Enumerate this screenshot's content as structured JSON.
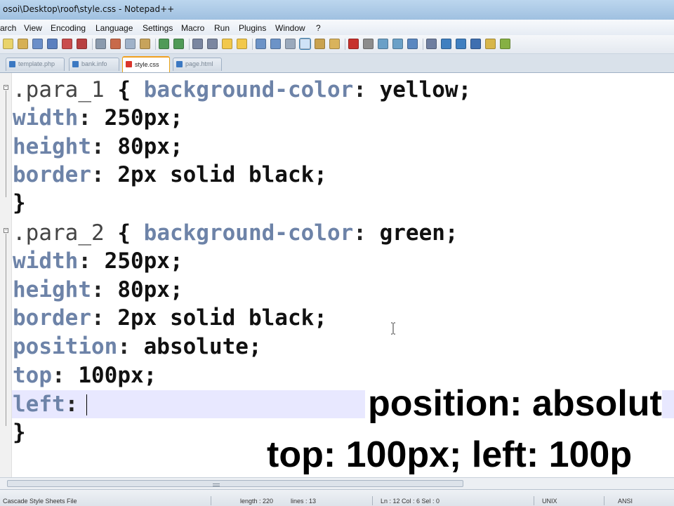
{
  "window": {
    "title": "osoi\\Desktop\\roof\\style.css - Notepad++"
  },
  "menu": {
    "items": [
      "arch",
      "View",
      "Encoding",
      "Language",
      "Settings",
      "Macro",
      "Run",
      "Plugins",
      "Window",
      "?"
    ]
  },
  "toolbar": {
    "icons": [
      "new-file-icon",
      "open-file-icon",
      "save-icon",
      "save-all-icon",
      "close-icon",
      "close-all-icon",
      "print-icon",
      "cut-icon",
      "copy-icon",
      "paste-icon",
      "undo-icon",
      "redo-icon",
      "find-icon",
      "replace-icon",
      "zoom-in-icon",
      "zoom-out-icon",
      "sync-scroll-icon",
      "word-wrap-icon",
      "show-all-chars-icon",
      "indent-guide-icon",
      "user-lang-icon",
      "doc-map-icon",
      "record-macro-icon",
      "stop-macro-icon",
      "play-macro-icon",
      "play-multi-icon",
      "save-macro-icon",
      "trim-icon",
      "up-icon",
      "down-icon",
      "collapse-icon",
      "fold-icon",
      "spell-icon"
    ]
  },
  "tabs": [
    {
      "label": "template.php",
      "active": false
    },
    {
      "label": "bank.info",
      "active": false
    },
    {
      "label": "style.css",
      "active": true
    },
    {
      "label": "page.html",
      "active": false
    }
  ],
  "editor": {
    "lines": [
      [
        {
          "t": ".para_1",
          "c": "sel-k"
        },
        {
          "t": " { ",
          "c": "brc"
        },
        {
          "t": "background-color",
          "c": "prop"
        },
        {
          "t": ": ",
          "c": "pun"
        },
        {
          "t": "yellow;",
          "c": "val"
        }
      ],
      [
        {
          "t": "width",
          "c": "prop"
        },
        {
          "t": ": ",
          "c": "pun"
        },
        {
          "t": "250px;",
          "c": "val"
        }
      ],
      [
        {
          "t": "height",
          "c": "prop"
        },
        {
          "t": ": ",
          "c": "pun"
        },
        {
          "t": "80px;",
          "c": "val"
        }
      ],
      [
        {
          "t": "border",
          "c": "prop"
        },
        {
          "t": ": ",
          "c": "pun"
        },
        {
          "t": "2px solid black;",
          "c": "val"
        }
      ],
      [
        {
          "t": "}",
          "c": "brc"
        }
      ],
      [
        {
          "t": ".para_2",
          "c": "sel-k"
        },
        {
          "t": " { ",
          "c": "brc"
        },
        {
          "t": "background-color",
          "c": "prop"
        },
        {
          "t": ": ",
          "c": "pun"
        },
        {
          "t": "green;",
          "c": "val"
        }
      ],
      [
        {
          "t": "width",
          "c": "prop"
        },
        {
          "t": ": ",
          "c": "pun"
        },
        {
          "t": "250px;",
          "c": "val"
        }
      ],
      [
        {
          "t": "height",
          "c": "prop"
        },
        {
          "t": ": ",
          "c": "pun"
        },
        {
          "t": "80px;",
          "c": "val"
        }
      ],
      [
        {
          "t": "border",
          "c": "prop"
        },
        {
          "t": ": ",
          "c": "pun"
        },
        {
          "t": "2px solid black;",
          "c": "val"
        }
      ],
      [
        {
          "t": "position",
          "c": "prop"
        },
        {
          "t": ": ",
          "c": "pun"
        },
        {
          "t": "absolute;",
          "c": "val"
        }
      ],
      [
        {
          "t": "top",
          "c": "prop"
        },
        {
          "t": ": ",
          "c": "pun"
        },
        {
          "t": "100px;",
          "c": "val"
        }
      ],
      [
        {
          "t": "left",
          "c": "prop"
        },
        {
          "t": ":",
          "c": "pun"
        }
      ],
      [
        {
          "t": "}",
          "c": "brc"
        }
      ]
    ]
  },
  "captions": {
    "line1": "position: absolut",
    "line2": "top: 100px;  left: 100p"
  },
  "status": {
    "file_type": "Cascade Style Sheets File",
    "length": "length : 220",
    "lines": "lines : 13",
    "position": "Ln : 12   Col : 6   Sel : 0",
    "eol": "UNIX",
    "encoding": "ANSI"
  },
  "colors": {
    "property": "#6d83a8",
    "current_line": "#e8e8ff",
    "active_tab_accent": "#f0a020"
  }
}
